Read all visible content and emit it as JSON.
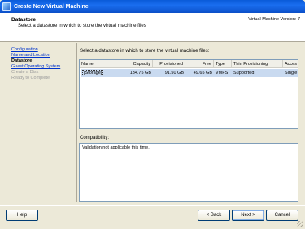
{
  "window": {
    "title": "Create New Virtual Machine"
  },
  "header": {
    "title": "Datastore",
    "subtitle": "Select a datastore in which to store the virtual machine files",
    "version": "Virtual Machine Version: 7"
  },
  "steps": [
    {
      "label": "Configuration",
      "state": "link"
    },
    {
      "label": "Name and Location",
      "state": "link"
    },
    {
      "label": "Datastore",
      "state": "current"
    },
    {
      "label": "Guest Operating System",
      "state": "link"
    },
    {
      "label": "Create a Disk",
      "state": "disabled"
    },
    {
      "label": "Ready to Complete",
      "state": "disabled"
    }
  ],
  "datastore": {
    "label": "Select a datastore in which to store the virtual machine files:",
    "columns": [
      "Name",
      "Capacity",
      "Provisioned",
      "Free",
      "Type",
      "Thin Provisioning",
      "Acces"
    ],
    "rows": [
      {
        "name": "[Storage]",
        "capacity": "134.75 GB",
        "provisioned": "91.50 GB",
        "free": "49.65 GB",
        "type": "VMFS",
        "thin": "Supported",
        "access": "Single"
      }
    ]
  },
  "compatibility": {
    "label": "Compatibility:",
    "text": "Validation not applicable this time."
  },
  "buttons": {
    "help": "Help",
    "back": "< Back",
    "next": "Next >",
    "cancel": "Cancel"
  }
}
